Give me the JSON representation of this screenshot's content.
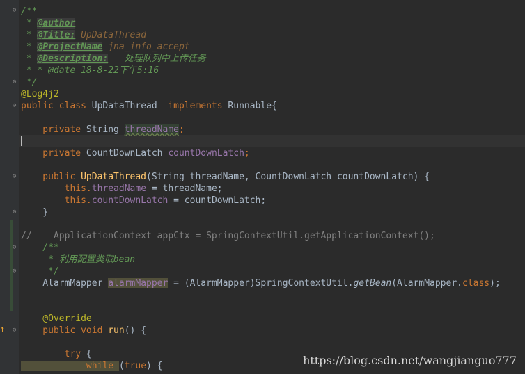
{
  "code": {
    "l1": "/**",
    "l2_star": " * ",
    "l2_tag": "@author",
    "l3_star": " * ",
    "l3_tag": "@Title:",
    "l3_val": " UpDataThread",
    "l4_star": " * ",
    "l4_tag": "@ProjectName",
    "l4_val": " jna_info_accept",
    "l5_star": " * ",
    "l5_tag": "@Description:",
    "l5_val": "   处理队列中上传任务",
    "l6": " * * @date 18-8-22下午5:16",
    "l7": " */",
    "l8": "@Log4j2",
    "l9_kw": "public class ",
    "l9_name": "UpDataThread  ",
    "l9_kw2": "implements ",
    "l9_rest": "Runnable{",
    "l11_kw": "    private ",
    "l11_type": "String ",
    "l11_field": "threadName",
    "l11_semi": ";",
    "l13_kw": "    private ",
    "l13_type": "CountDownLatch ",
    "l13_field": "countDownLatch",
    "l13_semi": ";",
    "l15_kw": "    public ",
    "l15_fn": "UpDataThread",
    "l15_p1": "(String threadName, CountDownLatch countDownLatch) {",
    "l16_kw": "        this.",
    "l16_field": "threadName",
    "l16_rest": " = threadName;",
    "l17_kw": "        this.",
    "l17_field": "countDownLatch",
    "l17_rest": " = countDownLatch;",
    "l18": "    }",
    "l20": "//    ApplicationContext appCtx = SpringContextUtil.getApplicationContext();",
    "l21": "    /**",
    "l22": "     * 利用配置类取bean",
    "l23": "     */",
    "l24_a": "    AlarmMapper ",
    "l24_field": "alarmMapper",
    "l24_b": " = (AlarmMapper)SpringContextUtil.",
    "l24_fn": "getBean",
    "l24_c": "(AlarmMapper.",
    "l24_kw": "class",
    "l24_d": ");",
    "l27": "    @Override",
    "l28_kw": "    public void ",
    "l28_fn": "run",
    "l28_rest": "() {",
    "l30_kw": "        try ",
    "l30_rest": "{",
    "l31_kw": "            while ",
    "l31_rest": "(true) {",
    "l31_true": "true"
  },
  "watermark": "https://blog.csdn.net/wangjianguo777"
}
